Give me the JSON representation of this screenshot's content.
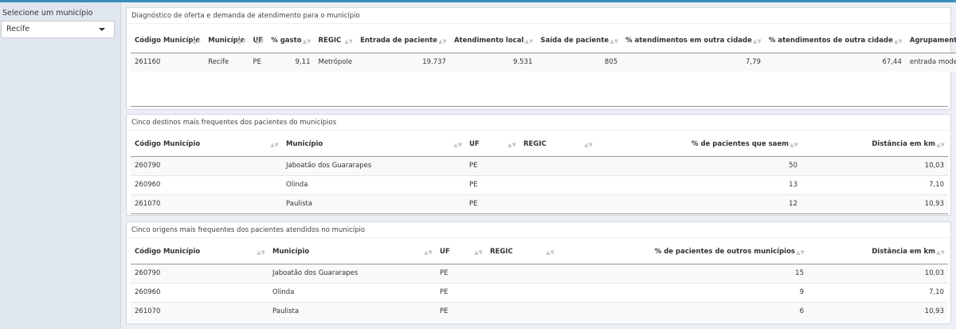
{
  "sidebar": {
    "label": "Selecione um município",
    "selected": "Recife"
  },
  "box1": {
    "title": "Diagnóstico de oferta e demanda de atendimento para o município",
    "headers": [
      "Código Município",
      "Município",
      "UF",
      "% gasto",
      "REGIC",
      "Entrada de paciente",
      "Atendimento local",
      "Saída de paciente",
      "% atendimentos em outra cidade",
      "% atendimentos de outra cidade",
      "Agrupamento"
    ],
    "rows": [
      [
        "261160",
        "Recife",
        "PE",
        "9,11",
        "Metrópole",
        "19.737",
        "9.531",
        "805",
        "7,79",
        "67,44",
        "entrada moderada"
      ]
    ]
  },
  "box2": {
    "title": "Cinco destinos mais frequentes dos pacientes do municípios",
    "headers": [
      "Código Município",
      "Município",
      "UF",
      "REGIC",
      "% de pacientes que saem",
      "Distância em km"
    ],
    "rows": [
      [
        "260790",
        "Jaboatão dos Guararapes",
        "PE",
        "",
        "50",
        "10,03"
      ],
      [
        "260960",
        "Olinda",
        "PE",
        "",
        "13",
        "7,10"
      ],
      [
        "261070",
        "Paulista",
        "PE",
        "",
        "12",
        "10,93"
      ]
    ]
  },
  "box3": {
    "title": "Cinco origens mais frequentes dos pacientes atendidos no município",
    "headers": [
      "Código Município",
      "Município",
      "UF",
      "REGIC",
      "% de pacientes de outros municípios",
      "Distância em km"
    ],
    "rows": [
      [
        "260790",
        "Jaboatão dos Guararapes",
        "PE",
        "",
        "15",
        "10,03"
      ],
      [
        "260960",
        "Olinda",
        "PE",
        "",
        "9",
        "7,10"
      ],
      [
        "261070",
        "Paulista",
        "PE",
        "",
        "6",
        "10,93"
      ]
    ]
  },
  "icons": {
    "sort": "sort-arrows-icon",
    "dropdown": "caret-down-icon"
  },
  "colors": {
    "accent": "#3c8dbc",
    "sidebar": "#dfe6f0",
    "background": "#ecf0f5"
  }
}
